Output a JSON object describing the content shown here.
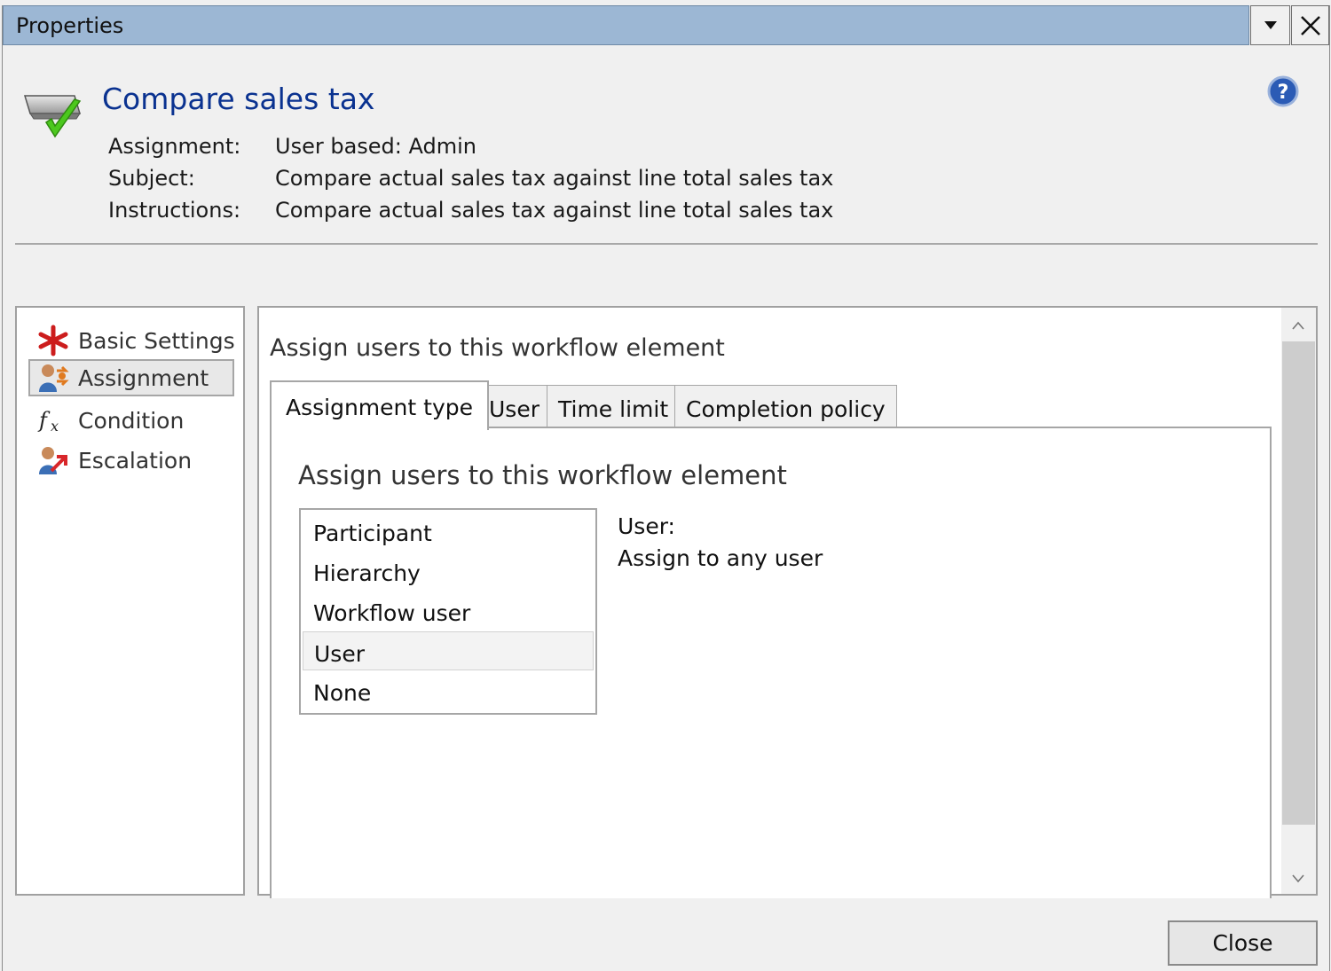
{
  "window": {
    "title": "Properties",
    "icons": {
      "dropdown": "chevron-down-icon",
      "close": "close-icon",
      "help": "help-icon"
    }
  },
  "header": {
    "title": "Compare sales tax",
    "icon": "workflow-task-check-icon",
    "fields": [
      {
        "label": "Assignment:",
        "value": "User based: Admin"
      },
      {
        "label": "Subject:",
        "value": "Compare actual sales tax against line total sales tax"
      },
      {
        "label": "Instructions:",
        "value": "Compare actual sales tax against line total sales tax"
      }
    ]
  },
  "nav": {
    "items": [
      {
        "label": "Basic Settings",
        "icon": "asterisk-icon",
        "selected": false
      },
      {
        "label": "Assignment",
        "icon": "user-assignment-icon",
        "selected": true
      },
      {
        "label": "Condition",
        "icon": "function-icon",
        "selected": false
      },
      {
        "label": "Escalation",
        "icon": "user-escalation-icon",
        "selected": false
      }
    ]
  },
  "content": {
    "heading": "Assign users to this workflow element",
    "tabs": [
      {
        "label": "Assignment type",
        "active": true
      },
      {
        "label": "User",
        "active": false
      },
      {
        "label": "Time limit",
        "active": false
      },
      {
        "label": "Completion policy",
        "active": false
      }
    ],
    "tab_heading": "Assign users to this workflow element",
    "assignment_types": [
      "Participant",
      "Hierarchy",
      "Workflow user",
      "User",
      "None"
    ],
    "selected_type": "User",
    "detail_label": "User:",
    "detail_value": "Assign to any user"
  },
  "footer": {
    "close_label": "Close"
  },
  "colors": {
    "titlebar": "#9cb7d4",
    "title_text": "#0a3290",
    "checkmark": "#4cc81e",
    "asterisk": "#cc1d1d"
  }
}
